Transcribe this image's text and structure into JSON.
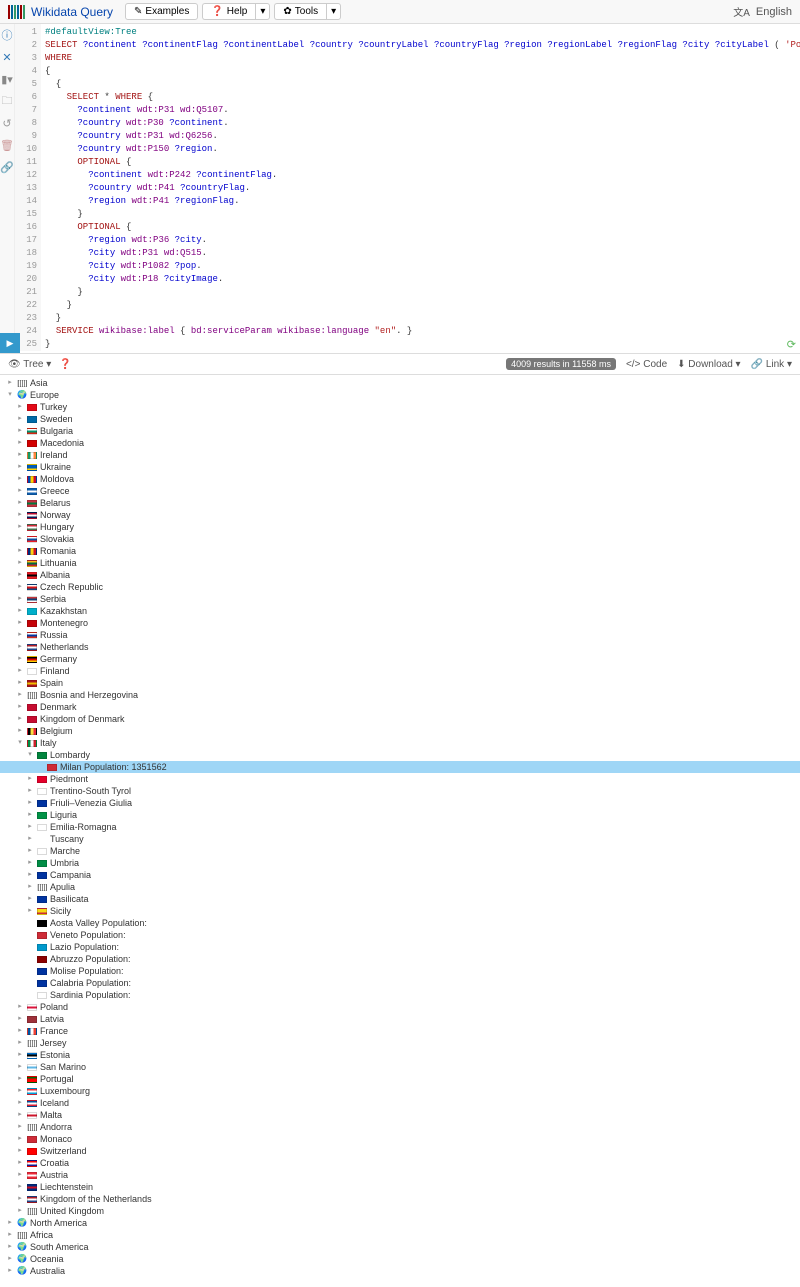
{
  "header": {
    "title": "Wikidata Query",
    "examples_btn": "Examples",
    "help_btn": "Help",
    "tools_btn": "Tools",
    "language": "English"
  },
  "code_lines": [
    {
      "n": 1,
      "html": "<span class='pfx'>#defaultView:Tree</span>"
    },
    {
      "n": 2,
      "html": "<span class='kw'>SELECT</span> <span class='var'>?continent</span> <span class='var'>?continentFlag</span> <span class='var'>?continentLabel</span> <span class='var'>?country</span> <span class='var'>?countryLabel</span> <span class='var'>?countryFlag</span> <span class='var'>?region</span> <span class='var'>?regionLabel</span> <span class='var'>?regionFlag</span> <span class='var'>?city</span> <span class='var'>?cityLabel</span> ( <span class='str'>'Population:'</span> <span class='kw'>as</span> <span class='var'>?popLabel</span> )  <span class='var'>?pop</span>  <span class='var'>?cityImage</span>"
    },
    {
      "n": 3,
      "html": "<span class='kw'>WHERE</span>"
    },
    {
      "n": 4,
      "html": "{"
    },
    {
      "n": 5,
      "html": "  {"
    },
    {
      "n": 6,
      "html": "    <span class='kw'>SELECT</span> * <span class='kw'>WHERE</span> {"
    },
    {
      "n": 7,
      "html": "      <span class='var'>?continent</span> <span class='prop'>wdt:P31</span> <span class='prop'>wd:Q5107</span>."
    },
    {
      "n": 8,
      "html": "      <span class='var'>?country</span> <span class='prop'>wdt:P30</span> <span class='var'>?continent</span>."
    },
    {
      "n": 9,
      "html": "      <span class='var'>?country</span> <span class='prop'>wdt:P31</span> <span class='prop'>wd:Q6256</span>."
    },
    {
      "n": 10,
      "html": "      <span class='var'>?country</span> <span class='prop'>wdt:P150</span> <span class='var'>?region</span>."
    },
    {
      "n": 11,
      "html": "      <span class='kw'>OPTIONAL</span> {"
    },
    {
      "n": 12,
      "html": "        <span class='var'>?continent</span> <span class='prop'>wdt:P242</span> <span class='var'>?continentFlag</span>."
    },
    {
      "n": 13,
      "html": "        <span class='var'>?country</span> <span class='prop'>wdt:P41</span> <span class='var'>?countryFlag</span>."
    },
    {
      "n": 14,
      "html": "        <span class='var'>?region</span> <span class='prop'>wdt:P41</span> <span class='var'>?regionFlag</span>."
    },
    {
      "n": 15,
      "html": "      }"
    },
    {
      "n": 16,
      "html": "      <span class='kw'>OPTIONAL</span> {"
    },
    {
      "n": 17,
      "html": "        <span class='var'>?region</span> <span class='prop'>wdt:P36</span> <span class='var'>?city</span>."
    },
    {
      "n": 18,
      "html": "        <span class='var'>?city</span> <span class='prop'>wdt:P31</span> <span class='prop'>wd:Q515</span>."
    },
    {
      "n": 19,
      "html": "        <span class='var'>?city</span> <span class='prop'>wdt:P1082</span> <span class='var'>?pop</span>."
    },
    {
      "n": 20,
      "html": "        <span class='var'>?city</span> <span class='prop'>wdt:P18</span> <span class='var'>?cityImage</span>."
    },
    {
      "n": 21,
      "html": "      }"
    },
    {
      "n": 22,
      "html": "    }"
    },
    {
      "n": 23,
      "html": "  }"
    },
    {
      "n": 24,
      "html": "  <span class='kw'>SERVICE</span> <span class='prop'>wikibase:label</span> { <span class='prop'>bd:serviceParam</span> <span class='prop'>wikibase:language</span> <span class='str'>\"en\"</span>. }"
    },
    {
      "n": 25,
      "html": "}"
    }
  ],
  "results_bar": {
    "tree_label": "Tree",
    "badge": "4009 results in 11558 ms",
    "code": "Code",
    "download": "Download",
    "link": "Link"
  },
  "tree": [
    {
      "indent": 0,
      "caret": "right",
      "flag": "bars",
      "label": "Asia"
    },
    {
      "indent": 0,
      "caret": "down",
      "flag": "globe",
      "label": "Europe"
    },
    {
      "indent": 1,
      "caret": "right",
      "flag": "#E30A17",
      "label": "Turkey"
    },
    {
      "indent": 1,
      "caret": "right",
      "flag": "#006AA7",
      "label": "Sweden"
    },
    {
      "indent": 1,
      "caret": "right",
      "flag": "tricolor-h",
      "colors": [
        "#fff",
        "#00966E",
        "#D62612"
      ],
      "label": "Bulgaria"
    },
    {
      "indent": 1,
      "caret": "right",
      "flag": "#D20000",
      "label": "Macedonia"
    },
    {
      "indent": 1,
      "caret": "right",
      "flag": "tricolor-v",
      "colors": [
        "#169B62",
        "#fff",
        "#FF883E"
      ],
      "label": "Ireland"
    },
    {
      "indent": 1,
      "caret": "right",
      "flag": "tricolor-h",
      "colors": [
        "#005BBB",
        "#005BBB",
        "#FFD500"
      ],
      "label": "Ukraine"
    },
    {
      "indent": 1,
      "caret": "right",
      "flag": "tricolor-v",
      "colors": [
        "#0046AE",
        "#FFD200",
        "#CC092F"
      ],
      "label": "Moldova"
    },
    {
      "indent": 1,
      "caret": "right",
      "flag": "tricolor-h",
      "colors": [
        "#0D5EAF",
        "#fff",
        "#0D5EAF"
      ],
      "label": "Greece"
    },
    {
      "indent": 1,
      "caret": "right",
      "flag": "tricolor-h",
      "colors": [
        "#C8313E",
        "#007A3D",
        "#C8313E"
      ],
      "label": "Belarus"
    },
    {
      "indent": 1,
      "caret": "right",
      "flag": "tricolor-h",
      "colors": [
        "#BA0C2F",
        "#fff",
        "#00205B"
      ],
      "label": "Norway"
    },
    {
      "indent": 1,
      "caret": "right",
      "flag": "tricolor-h",
      "colors": [
        "#CE2939",
        "#fff",
        "#477050"
      ],
      "label": "Hungary"
    },
    {
      "indent": 1,
      "caret": "right",
      "flag": "tricolor-h",
      "colors": [
        "#fff",
        "#0B4EA2",
        "#EE1C25"
      ],
      "label": "Slovakia"
    },
    {
      "indent": 1,
      "caret": "right",
      "flag": "tricolor-v",
      "colors": [
        "#002B7F",
        "#FCD116",
        "#CE1126"
      ],
      "label": "Romania"
    },
    {
      "indent": 1,
      "caret": "right",
      "flag": "tricolor-h",
      "colors": [
        "#FDB913",
        "#006A44",
        "#C1272D"
      ],
      "label": "Lithuania"
    },
    {
      "indent": 1,
      "caret": "right",
      "flag": "tricolor-h",
      "colors": [
        "#ED1C24",
        "#000",
        "#ED1C24"
      ],
      "label": "Albania"
    },
    {
      "indent": 1,
      "caret": "right",
      "flag": "tricolor-h",
      "colors": [
        "#fff",
        "#D7141A",
        "#11457E"
      ],
      "label": "Czech Republic"
    },
    {
      "indent": 1,
      "caret": "right",
      "flag": "tricolor-h",
      "colors": [
        "#C6363C",
        "#0C4076",
        "#fff"
      ],
      "label": "Serbia"
    },
    {
      "indent": 1,
      "caret": "right",
      "flag": "#00AFCA",
      "label": "Kazakhstan"
    },
    {
      "indent": 1,
      "caret": "right",
      "flag": "tricolor-h",
      "colors": [
        "#C40308",
        "#C40308",
        "#C40308"
      ],
      "label": "Montenegro"
    },
    {
      "indent": 1,
      "caret": "right",
      "flag": "tricolor-h",
      "colors": [
        "#fff",
        "#0039A6",
        "#D52B1E"
      ],
      "label": "Russia"
    },
    {
      "indent": 1,
      "caret": "right",
      "flag": "tricolor-h",
      "colors": [
        "#AE1C28",
        "#fff",
        "#21468B"
      ],
      "label": "Netherlands"
    },
    {
      "indent": 1,
      "caret": "right",
      "flag": "tricolor-h",
      "colors": [
        "#000",
        "#DD0000",
        "#FFCE00"
      ],
      "label": "Germany"
    },
    {
      "indent": 1,
      "caret": "right",
      "flag": "#fff",
      "label": "Finland"
    },
    {
      "indent": 1,
      "caret": "right",
      "flag": "tricolor-h",
      "colors": [
        "#AA151B",
        "#F1BF00",
        "#AA151B"
      ],
      "label": "Spain"
    },
    {
      "indent": 1,
      "caret": "right",
      "flag": "bars",
      "label": "Bosnia and Herzegovina"
    },
    {
      "indent": 1,
      "caret": "right",
      "flag": "#C60C30",
      "label": "Denmark"
    },
    {
      "indent": 1,
      "caret": "right",
      "flag": "#C60C30",
      "label": "Kingdom of Denmark"
    },
    {
      "indent": 1,
      "caret": "right",
      "flag": "tricolor-v",
      "colors": [
        "#000",
        "#FAE042",
        "#ED2939"
      ],
      "label": "Belgium"
    },
    {
      "indent": 1,
      "caret": "down",
      "flag": "tricolor-v",
      "colors": [
        "#008C45",
        "#fff",
        "#CD212A"
      ],
      "label": "Italy"
    },
    {
      "indent": 2,
      "caret": "down",
      "flag": "#00843D",
      "label": "Lombardy"
    },
    {
      "indent": 3,
      "caret": "",
      "flag": "#CE2B37",
      "label": "Milan Population: 1351562",
      "selected": true
    },
    {
      "indent": 2,
      "caret": "right",
      "flag": "#E4002B",
      "label": "Piedmont"
    },
    {
      "indent": 2,
      "caret": "right",
      "flag": "#fff",
      "label": "Trentino-South Tyrol"
    },
    {
      "indent": 2,
      "caret": "right",
      "flag": "#0033A0",
      "label": "Friuli–Venezia Giulia"
    },
    {
      "indent": 2,
      "caret": "right",
      "flag": "#009246",
      "label": "Liguria"
    },
    {
      "indent": 2,
      "caret": "right",
      "flag": "#fff",
      "label": "Emilia-Romagna"
    },
    {
      "indent": 2,
      "caret": "right",
      "flag": "none",
      "label": "Tuscany"
    },
    {
      "indent": 2,
      "caret": "right",
      "flag": "#fff",
      "label": "Marche"
    },
    {
      "indent": 2,
      "caret": "right",
      "flag": "#008C45",
      "label": "Umbria"
    },
    {
      "indent": 2,
      "caret": "right",
      "flag": "#0033A0",
      "label": "Campania"
    },
    {
      "indent": 2,
      "caret": "right",
      "flag": "bars",
      "label": "Apulia"
    },
    {
      "indent": 2,
      "caret": "right",
      "flag": "#0033A0",
      "label": "Basilicata"
    },
    {
      "indent": 2,
      "caret": "right",
      "flag": "tricolor-h",
      "colors": [
        "#F7D917",
        "#F7D917",
        "#CE2B37"
      ],
      "label": "Sicily"
    },
    {
      "indent": 2,
      "caret": "",
      "flag": "#000",
      "label": "Aosta Valley Population:"
    },
    {
      "indent": 2,
      "caret": "",
      "flag": "#CE2B37",
      "label": "Veneto Population:"
    },
    {
      "indent": 2,
      "caret": "",
      "flag": "#0099cc",
      "label": "Lazio Population:"
    },
    {
      "indent": 2,
      "caret": "",
      "flag": "#8B0000",
      "label": "Abruzzo Population:"
    },
    {
      "indent": 2,
      "caret": "",
      "flag": "#0033A0",
      "label": "Molise Population:"
    },
    {
      "indent": 2,
      "caret": "",
      "flag": "#0033A0",
      "label": "Calabria Population:"
    },
    {
      "indent": 2,
      "caret": "",
      "flag": "#fff",
      "label": "Sardinia Population:"
    },
    {
      "indent": 1,
      "caret": "right",
      "flag": "tricolor-h",
      "colors": [
        "#fff",
        "#DC143C",
        "#fff"
      ],
      "label": "Poland"
    },
    {
      "indent": 1,
      "caret": "right",
      "flag": "#9E3039",
      "label": "Latvia"
    },
    {
      "indent": 1,
      "caret": "right",
      "flag": "tricolor-v",
      "colors": [
        "#0055A4",
        "#fff",
        "#EF4135"
      ],
      "label": "France"
    },
    {
      "indent": 1,
      "caret": "right",
      "flag": "bars",
      "label": "Jersey"
    },
    {
      "indent": 1,
      "caret": "right",
      "flag": "tricolor-h",
      "colors": [
        "#0072CE",
        "#000",
        "#fff"
      ],
      "label": "Estonia"
    },
    {
      "indent": 1,
      "caret": "right",
      "flag": "tricolor-h",
      "colors": [
        "#fff",
        "#5EB6E4",
        "#fff"
      ],
      "label": "San Marino"
    },
    {
      "indent": 1,
      "caret": "right",
      "flag": "tricolor-h",
      "colors": [
        "#006600",
        "#FF0000",
        "#FF0000"
      ],
      "label": "Portugal"
    },
    {
      "indent": 1,
      "caret": "right",
      "flag": "tricolor-h",
      "colors": [
        "#ED2939",
        "#fff",
        "#00A1DE"
      ],
      "label": "Luxembourg"
    },
    {
      "indent": 1,
      "caret": "right",
      "flag": "tricolor-h",
      "colors": [
        "#02529C",
        "#fff",
        "#DC1E35"
      ],
      "label": "Iceland"
    },
    {
      "indent": 1,
      "caret": "right",
      "flag": "tricolor-h",
      "colors": [
        "#fff",
        "#CF142B",
        "#fff"
      ],
      "label": "Malta"
    },
    {
      "indent": 1,
      "caret": "right",
      "flag": "bars",
      "label": "Andorra"
    },
    {
      "indent": 1,
      "caret": "right",
      "flag": "#CE2B37",
      "label": "Monaco"
    },
    {
      "indent": 1,
      "caret": "right",
      "flag": "#FF0000",
      "label": "Switzerland"
    },
    {
      "indent": 1,
      "caret": "right",
      "flag": "tricolor-h",
      "colors": [
        "#FF0000",
        "#fff",
        "#171796"
      ],
      "label": "Croatia"
    },
    {
      "indent": 1,
      "caret": "right",
      "flag": "tricolor-h",
      "colors": [
        "#ED2939",
        "#fff",
        "#ED2939"
      ],
      "label": "Austria"
    },
    {
      "indent": 1,
      "caret": "right",
      "flag": "tricolor-h",
      "colors": [
        "#002B7F",
        "#CE1126",
        "#002B7F"
      ],
      "label": "Liechtenstein"
    },
    {
      "indent": 1,
      "caret": "right",
      "flag": "tricolor-h",
      "colors": [
        "#AE1C28",
        "#fff",
        "#21468B"
      ],
      "label": "Kingdom of the Netherlands"
    },
    {
      "indent": 1,
      "caret": "right",
      "flag": "bars",
      "label": "United Kingdom"
    },
    {
      "indent": 0,
      "caret": "right",
      "flag": "globe",
      "label": "North America"
    },
    {
      "indent": 0,
      "caret": "right",
      "flag": "bars",
      "label": "Africa"
    },
    {
      "indent": 0,
      "caret": "right",
      "flag": "globe",
      "label": "South America"
    },
    {
      "indent": 0,
      "caret": "right",
      "flag": "globe",
      "label": "Oceania"
    },
    {
      "indent": 0,
      "caret": "right",
      "flag": "globe",
      "label": "Australia"
    }
  ]
}
